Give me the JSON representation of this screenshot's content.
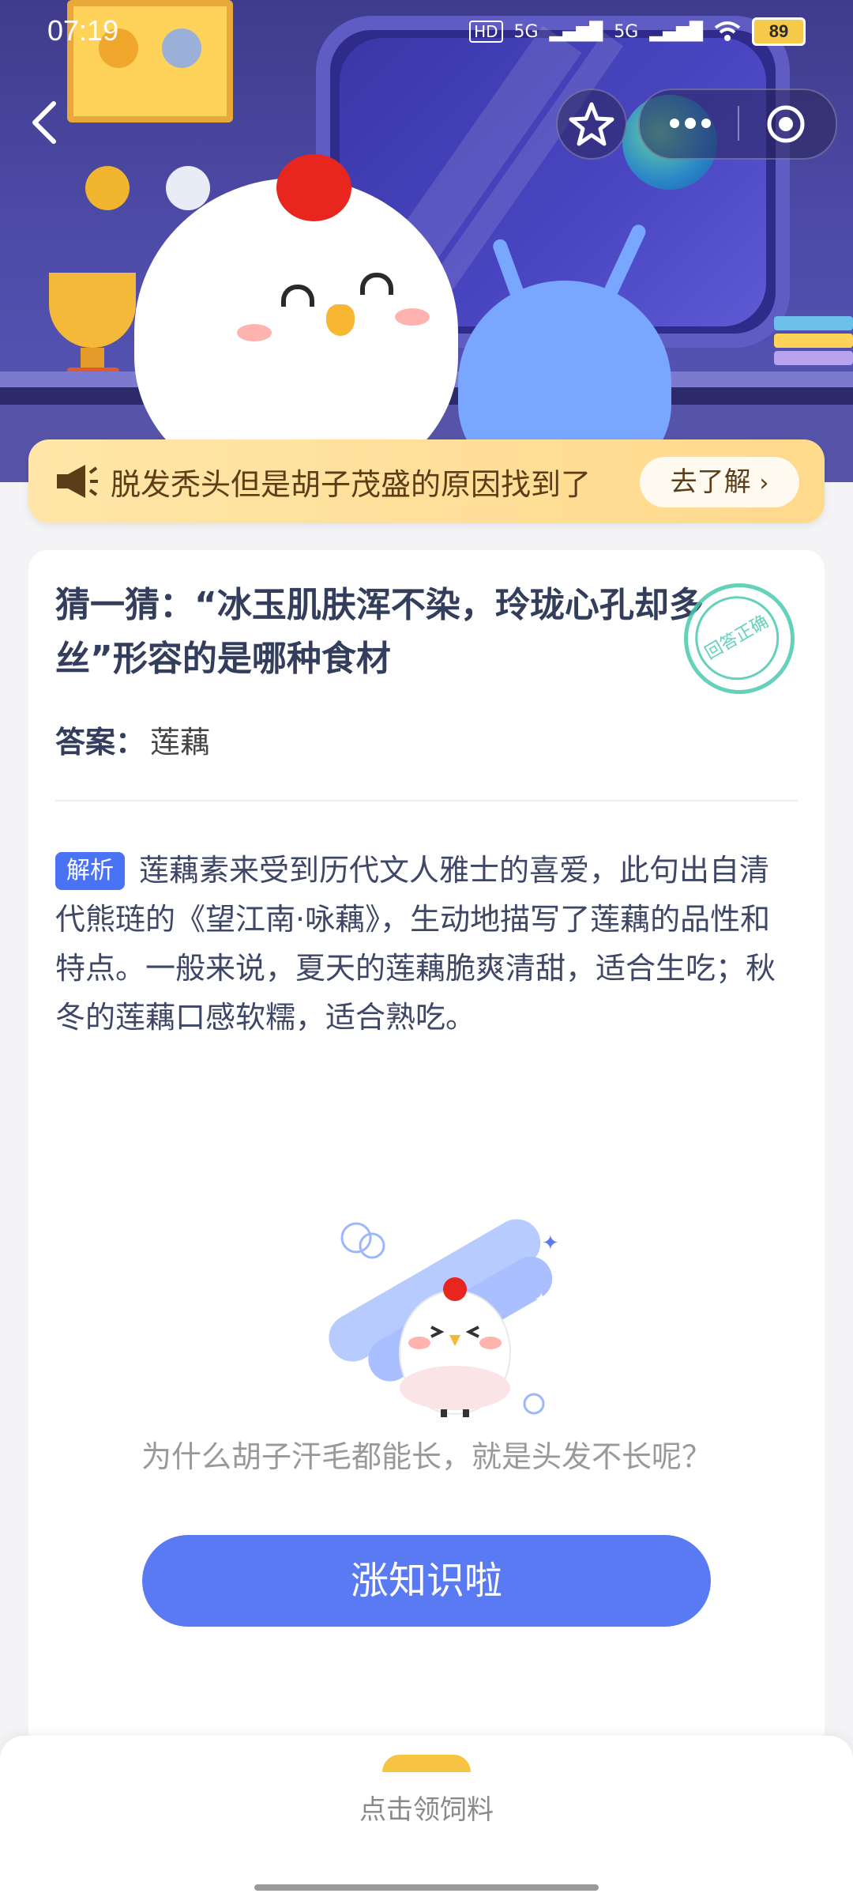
{
  "status_bar": {
    "time": "07:19",
    "network_1": "5G",
    "network_2": "5G",
    "battery": "89"
  },
  "nav": {
    "back_icon": "chevron-left-icon",
    "star_icon": "star-icon",
    "more_icon": "more-dots-icon",
    "target_icon": "target-icon"
  },
  "banner": {
    "icon": "megaphone-icon",
    "text": "脱发秃头但是胡子茂盛的原因找到了",
    "button_label": "去了解"
  },
  "question": {
    "text": "猜一猜：“冰玉肌肤浑不染，玲珑心孔却多丝”形容的是哪种食材",
    "stamp_text": "回答正确"
  },
  "answer": {
    "label": "答案：",
    "value": "莲藕"
  },
  "analysis": {
    "tag": "解析",
    "text": "莲藕素来受到历代文人雅士的喜爱，此句出自清代熊琏的《望江南·咏藕》，生动地描写了莲藕的品性和特点。一般来说，夏天的莲藕脆爽清甜，适合生吃；秋冬的莲藕口感软糯，适合熟吃。"
  },
  "promo": {
    "question_text": "为什么胡子汗毛都能长，就是头发不长呢？",
    "cta_label": "涨知识啦"
  },
  "bottom": {
    "feed_text": "点击领饲料"
  },
  "colors": {
    "accent": "#5a7af3",
    "tag_blue": "#4a72f5",
    "banner_bg": "#ffd98c",
    "stamp_green": "#49c9b0"
  }
}
